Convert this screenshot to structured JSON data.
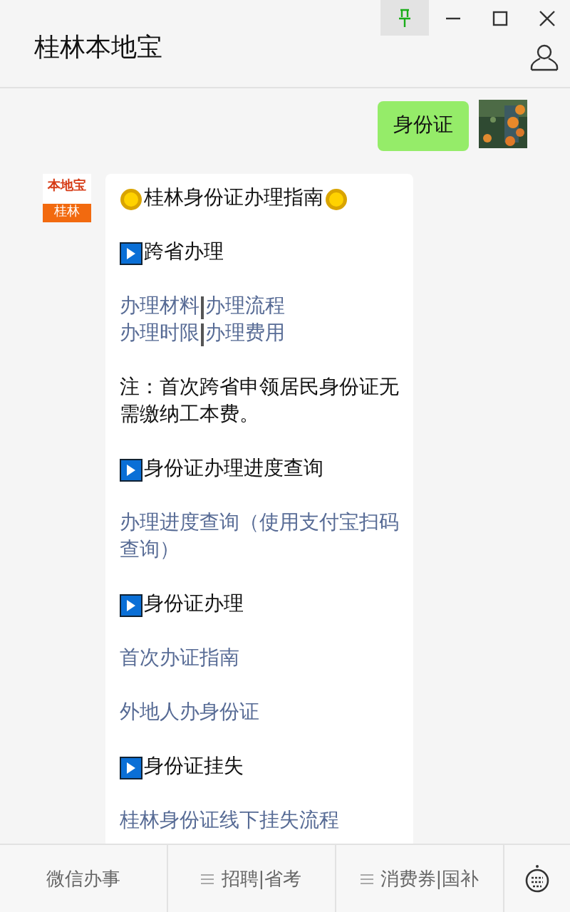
{
  "window": {
    "title": "桂林本地宝",
    "pinned": true
  },
  "messages": [
    {
      "kind": "user",
      "text": "身份证"
    },
    {
      "kind": "bot",
      "avatar_top": "本地宝",
      "avatar_bottom": "桂林",
      "blocks": [
        {
          "kind": "title",
          "text": "桂林身份证办理指南"
        },
        {
          "kind": "heading",
          "text": "跨省办理"
        },
        {
          "kind": "link_rows",
          "rows": [
            [
              "办理材料",
              "办理流程"
            ],
            [
              "办理时限",
              "办理费用"
            ]
          ]
        },
        {
          "kind": "note",
          "text": "注：首次跨省申领居民身份证无需缴纳工本费。"
        },
        {
          "kind": "heading",
          "text": "身份证办理进度查询"
        },
        {
          "kind": "link_rows",
          "rows": [
            [
              "办理进度查询（使用支付宝扫码查询）"
            ]
          ]
        },
        {
          "kind": "heading",
          "text": "身份证办理"
        },
        {
          "kind": "link_rows",
          "rows": [
            [
              "首次办证指南"
            ]
          ]
        },
        {
          "kind": "link_rows",
          "rows": [
            [
              "外地人办身份证"
            ]
          ]
        },
        {
          "kind": "heading",
          "text": "身份证挂失"
        },
        {
          "kind": "link_rows",
          "rows": [
            [
              "桂林身份证线下挂失流程"
            ]
          ]
        }
      ]
    }
  ],
  "menu": [
    {
      "label": "微信办事",
      "has_submenu": false
    },
    {
      "label": "招聘|省考",
      "has_submenu": true
    },
    {
      "label": "消费券|国补",
      "has_submenu": true
    }
  ]
}
